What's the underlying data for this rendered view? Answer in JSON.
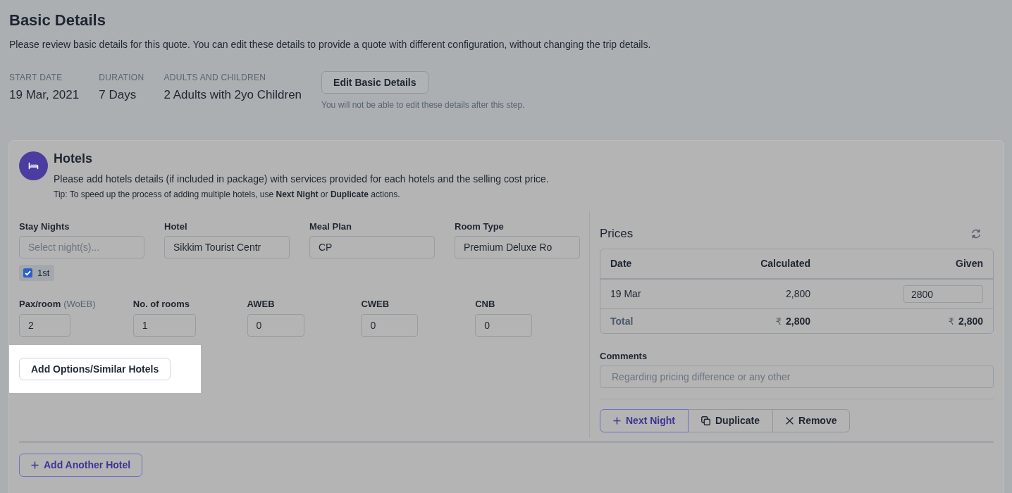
{
  "header": {
    "title": "Basic Details",
    "description": "Please review basic details for this quote. You can edit these details to provide a quote with different configuration, without changing the trip details.",
    "details": [
      {
        "label": "START DATE",
        "value": "19 Mar, 2021"
      },
      {
        "label": "DURATION",
        "value": "7 Days"
      },
      {
        "label": "ADULTS AND CHILDREN",
        "value": "2 Adults with 2yo Children"
      }
    ],
    "edit_button": "Edit Basic Details",
    "edit_note": "You will not be able to edit these details after this step."
  },
  "hotels": {
    "title": "Hotels",
    "description": "Please add hotels details (if included in package) with services provided for each hotels and the selling cost price.",
    "tip": "Tip: To speed up the process of adding multiple hotels, use **Next Night** or **Duplicate** actions.",
    "fields": [
      {
        "label": "Stay Nights",
        "placeholder": "Select night(s)..."
      },
      {
        "label": "Hotel",
        "value": "Sikkim Tourist Centr"
      },
      {
        "label": "Meal Plan",
        "value": "CP"
      },
      {
        "label": "Room Type",
        "value": "Premium Deluxe Ro"
      }
    ],
    "nights": [
      {
        "label": "1st",
        "checked": true
      }
    ],
    "counts": [
      {
        "label": "Pax/room",
        "hint": "(WoEB)",
        "value": "2"
      },
      {
        "label": "No. of rooms",
        "value": "1"
      },
      {
        "label": "AWEB",
        "value": "0"
      },
      {
        "label": "CWEB",
        "value": "0"
      },
      {
        "label": "CNB",
        "value": "0"
      }
    ],
    "options_button": {
      "label": "Add Options/Similar Hotels",
      "highlighted": true
    },
    "prices": {
      "title": "Prices",
      "columns": [
        "Date",
        "Calculated",
        "Given"
      ],
      "rows": [
        {
          "date": "19 Mar",
          "calculated": "2,800",
          "given": "2800"
        }
      ],
      "total": {
        "label": "Total",
        "calculated": {
          "currency": "₹",
          "amount": "2,800"
        },
        "given": {
          "currency": "₹",
          "amount": "2,800"
        }
      }
    },
    "comments": {
      "label": "Comments",
      "placeholder": "Regarding pricing difference or any other"
    },
    "actions": [
      {
        "kind": "add",
        "label": "Next Night"
      },
      {
        "kind": "duplicate",
        "label": "Duplicate"
      },
      {
        "kind": "remove",
        "label": "Remove"
      }
    ],
    "add_hotel_button": "Add Another Hotel"
  }
}
